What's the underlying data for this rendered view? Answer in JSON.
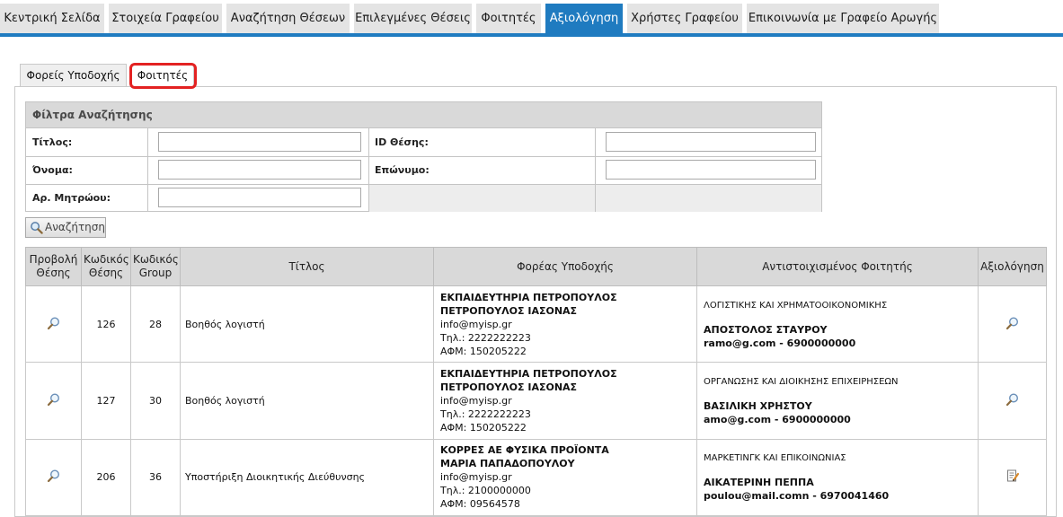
{
  "nav": {
    "tabs": [
      {
        "label": "Κεντρική Σελίδα"
      },
      {
        "label": "Στοιχεία Γραφείου"
      },
      {
        "label": "Αναζήτηση Θέσεων"
      },
      {
        "label": "Επιλεγμένες Θέσεις"
      },
      {
        "label": "Φοιτητές"
      },
      {
        "label": "Αξιολόγηση"
      },
      {
        "label": "Χρήστες Γραφείου"
      },
      {
        "label": "Επικοινωνία με Γραφείο Αρωγής"
      }
    ],
    "active_index": 5,
    "accent_color": "#1f7bc0"
  },
  "subtabs": [
    {
      "label": "Φορείς Υποδοχής"
    },
    {
      "label": "Φοιτητές"
    }
  ],
  "filters": {
    "title": "Φίλτρα Αναζήτησης",
    "labels": {
      "title": "Τίτλος:",
      "position_id": "ID Θέσης:",
      "first_name": "Όνομα:",
      "last_name": "Επώνυμο:",
      "registry_no": "Αρ. Μητρώου:"
    },
    "values": {
      "title": "",
      "position_id": "",
      "first_name": "",
      "last_name": "",
      "registry_no": ""
    }
  },
  "search_button": {
    "label": "Αναζήτηση",
    "icon": "search-icon"
  },
  "table": {
    "headers": {
      "view": "Προβολή Θέσης",
      "code": "Κωδικός Θέσης",
      "group": "Κωδικός Group",
      "title": "Τίτλος",
      "host": "Φορέας Υποδοχής",
      "student": "Αντιστοιχισμένος Φοιτητής",
      "eval": "Αξιολόγηση"
    },
    "rows": [
      {
        "code": "126",
        "group": "28",
        "title": "Βοηθός λογιστή",
        "host_name": "ΕΚΠΑΙΔΕΥΤΗΡΙΑ ΠΕΤΡΟΠΟΥΛΟΣ",
        "host_contact": "ΠΕΤΡΟΠΟΥΛΟΣ ΙΑΣΟΝΑΣ",
        "host_email": "info@myisp.gr",
        "host_phone": "Τηλ.: 2222222223",
        "host_afm": "ΑΦΜ: 150205222",
        "student_dept": "ΛΟΓΙΣΤΙΚΗΣ ΚΑΙ ΧΡΗΜΑΤΟΟΙΚΟΝΟΜΙΚΗΣ",
        "student_name": "ΑΠΟΣΤΟΛΟΣ ΣΤΑΥΡΟΥ",
        "student_contact": "ramo@g.com  -  6900000000",
        "eval_icon": "magnifier-icon"
      },
      {
        "code": "127",
        "group": "30",
        "title": "Βοηθός λογιστή",
        "host_name": "ΕΚΠΑΙΔΕΥΤΗΡΙΑ ΠΕΤΡΟΠΟΥΛΟΣ",
        "host_contact": "ΠΕΤΡΟΠΟΥΛΟΣ ΙΑΣΟΝΑΣ",
        "host_email": "info@myisp.gr",
        "host_phone": "Τηλ.: 2222222223",
        "host_afm": "ΑΦΜ: 150205222",
        "student_dept": "ΟΡΓΑΝΩΣΗΣ ΚΑΙ ΔΙΟΙΚΗΣΗΣ ΕΠΙΧΕΙΡΗΣΕΩΝ",
        "student_name": "ΒΑΣΙΛΙΚΗ ΧΡΗΣΤΟΥ",
        "student_contact": "amo@g.com  -  6900000000",
        "eval_icon": "magnifier-icon"
      },
      {
        "code": "206",
        "group": "36",
        "title": "Υποστήριξη Διοικητικής Διεύθυνσης",
        "host_name": "ΚΟΡΡΕΣ ΑΕ ΦΥΣΙΚΑ ΠΡΟΪΟΝΤΑ",
        "host_contact": "ΜΑΡΙΑ ΠΑΠΑΔΟΠΟΥΛΟΥ",
        "host_email": "info@myisp.gr",
        "host_phone": "Τηλ.: 2100000000",
        "host_afm": "ΑΦΜ: 09564578",
        "student_dept": "ΜΑΡΚΕΤΙΝΓΚ ΚΑΙ ΕΠΙΚΟΙΝΩΝΙΑΣ",
        "student_name": "ΑΙΚΑΤΕΡΙΝΗ ΠΕΠΠΑ",
        "student_contact": "poulou@mail.comn  -  6970041460",
        "eval_icon": "edit-form-icon"
      }
    ]
  }
}
